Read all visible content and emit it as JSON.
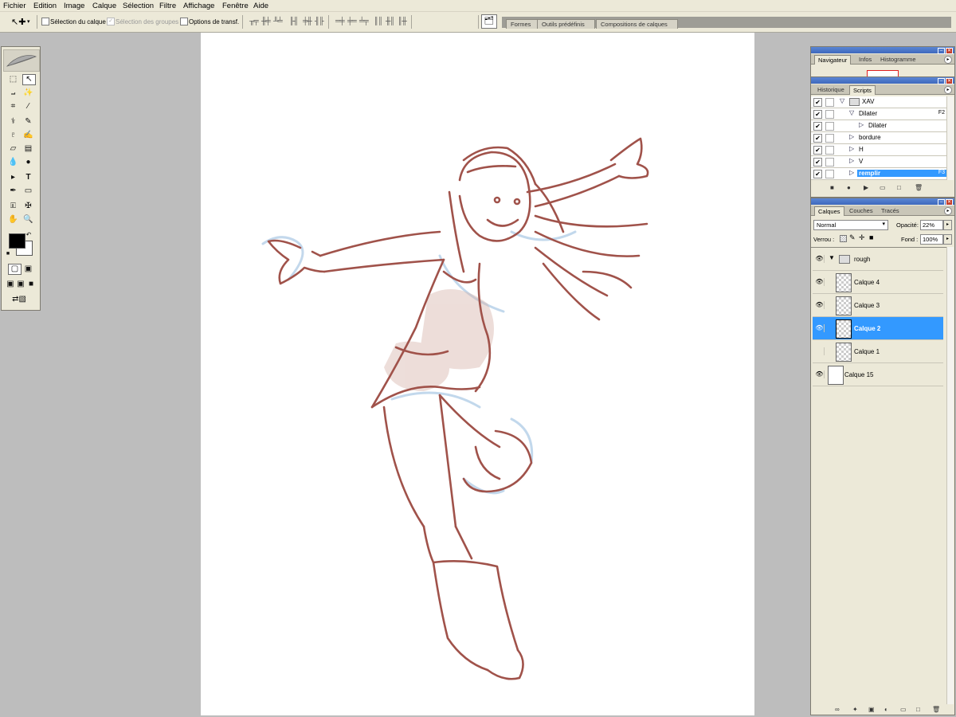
{
  "menu": [
    "Fichier",
    "Edition",
    "Image",
    "Calque",
    "Sélection",
    "Filtre",
    "Affichage",
    "Fenêtre",
    "Aide"
  ],
  "options": {
    "tool_icon": "move-tool-icon",
    "auto_select_layer": "Sélection du calque",
    "auto_select_groups": "Sélection des groupes",
    "transform_controls": "Options de transf."
  },
  "palette_well": {
    "tabs": [
      "Formes",
      "Outils prédéfinis",
      "Compositions de calques"
    ]
  },
  "navigator_panel": {
    "tabs": [
      "Navigateur",
      "Infos",
      "Histogramme"
    ],
    "active": "Navigateur"
  },
  "actions_panel": {
    "tabs": [
      "Historique",
      "Scripts"
    ],
    "active": "Scripts",
    "rows": [
      {
        "name": "XAV",
        "key": "",
        "indent": 0,
        "expanded": true,
        "folder": true
      },
      {
        "name": "Dilater",
        "key": "F2",
        "indent": 1,
        "expanded": true,
        "folder": false
      },
      {
        "name": "Dilater",
        "key": "",
        "indent": 2,
        "expanded": false,
        "folder": false
      },
      {
        "name": "bordure",
        "key": "",
        "indent": 1,
        "expanded": false,
        "folder": false
      },
      {
        "name": "H",
        "key": "",
        "indent": 1,
        "expanded": false,
        "folder": false
      },
      {
        "name": "V",
        "key": "",
        "indent": 1,
        "expanded": false,
        "folder": false
      },
      {
        "name": "remplir",
        "key": "F3",
        "indent": 1,
        "expanded": false,
        "folder": false,
        "selected": true
      }
    ]
  },
  "layers_panel": {
    "tabs": [
      "Calques",
      "Couches",
      "Tracés"
    ],
    "active": "Calques",
    "blend_mode": "Normal",
    "opacity_label": "Opacité:",
    "opacity_value": "22%",
    "lock_label": "Verrou :",
    "fill_label": "Fond :",
    "fill_value": "100%",
    "layers": [
      {
        "name": "rough",
        "visible": true,
        "group": true
      },
      {
        "name": "Calque 4",
        "visible": true
      },
      {
        "name": "Calque 3",
        "visible": true
      },
      {
        "name": "Calque 2",
        "visible": true,
        "selected": true
      },
      {
        "name": "Calque 1",
        "visible": false
      },
      {
        "name": "Calque 15",
        "visible": true
      }
    ]
  },
  "colors": {
    "sketch": "#a0524a",
    "blue_rough": "#bcd4ea",
    "selection": "#3399ff",
    "panel_title": "#4a77c9"
  }
}
